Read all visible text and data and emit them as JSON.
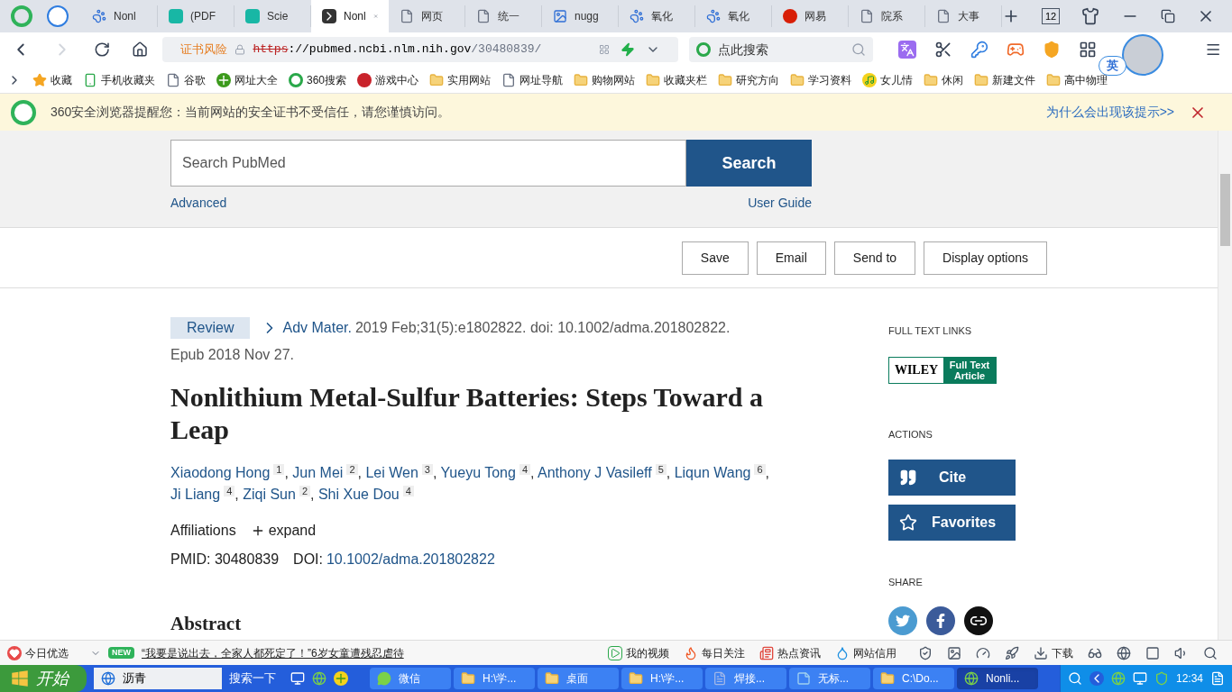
{
  "browser": {
    "tabs": [
      {
        "label": "Nonl",
        "kind": "paw",
        "selected": false
      },
      {
        "label": "(PDF",
        "kind": "rg",
        "selected": false
      },
      {
        "label": "Scie",
        "kind": "rg",
        "selected": false
      },
      {
        "label": "Nonl",
        "kind": "pubmed",
        "selected": true
      },
      {
        "label": "网页",
        "kind": "page",
        "selected": false
      },
      {
        "label": "统一",
        "kind": "page",
        "selected": false
      },
      {
        "label": "nugg",
        "kind": "photo",
        "selected": false
      },
      {
        "label": "氧化",
        "kind": "paw",
        "selected": false
      },
      {
        "label": "氧化",
        "kind": "paw",
        "selected": false
      },
      {
        "label": "网易",
        "kind": "netease",
        "selected": false
      },
      {
        "label": "院系",
        "kind": "page",
        "selected": false
      },
      {
        "label": "大事",
        "kind": "page",
        "selected": false
      }
    ],
    "tab_count": "12",
    "address": {
      "warning": "证书风险",
      "scheme": "https",
      "host": "://pubmed.ncbi.nlm.nih.gov",
      "path": "/30480839/"
    },
    "search": {
      "placeholder": "点此搜索"
    },
    "ime": "英",
    "bookmarks": [
      {
        "label": "收藏",
        "kind": "star"
      },
      {
        "label": "手机收藏夹",
        "kind": "phone"
      },
      {
        "label": "谷歌",
        "kind": "page"
      },
      {
        "label": "网址大全",
        "kind": "plus"
      },
      {
        "label": "360搜索",
        "kind": "ring"
      },
      {
        "label": "游戏中心",
        "kind": "game"
      },
      {
        "label": "实用网站",
        "kind": "folder"
      },
      {
        "label": "网址导航",
        "kind": "page"
      },
      {
        "label": "购物网站",
        "kind": "folder"
      },
      {
        "label": "收藏夹栏",
        "kind": "folder"
      },
      {
        "label": "研究方向",
        "kind": "folder"
      },
      {
        "label": "学习资料",
        "kind": "folder"
      },
      {
        "label": "女儿情",
        "kind": "music"
      },
      {
        "label": "休闲",
        "kind": "folder"
      },
      {
        "label": "新建文件",
        "kind": "folder"
      },
      {
        "label": "高中物理",
        "kind": "folder"
      }
    ],
    "notice": {
      "text": "360安全浏览器提醒您：当前网站的安全证书不受信任，请您谨慎访问。",
      "link": "为什么会出现该提示>>"
    }
  },
  "page": {
    "search": {
      "placeholder": "Search PubMed",
      "button": "Search",
      "advanced": "Advanced",
      "guide": "User Guide"
    },
    "actions": [
      "Save",
      "Email",
      "Send to",
      "Display options"
    ],
    "article": {
      "badge": "Review",
      "journal": "Adv Mater.",
      "citation": "2019 Feb;31(5):e1802822. doi: 10.1002/adma.201802822.",
      "epub": "Epub 2018 Nov 27.",
      "title": "Nonlithium Metal-Sulfur Batteries: Steps Toward a Leap",
      "authors": [
        {
          "name": "Xiaodong Hong",
          "aff": "1",
          "sep": ","
        },
        {
          "name": "Jun Mei",
          "aff": "2",
          "sep": ","
        },
        {
          "name": "Lei Wen",
          "aff": "3",
          "sep": ","
        },
        {
          "name": "Yueyu Tong",
          "aff": "4",
          "sep": ","
        },
        {
          "name": "Anthony J Vasileff",
          "aff": "5",
          "sep": ","
        },
        {
          "name": "Liqun Wang",
          "aff": "6",
          "sep": ","
        },
        {
          "name": "Ji Liang",
          "aff": "4",
          "sep": ","
        },
        {
          "name": "Ziqi Sun",
          "aff": "2",
          "sep": ","
        },
        {
          "name": "Shi Xue Dou",
          "aff": "4"
        }
      ],
      "affiliations": "Affiliations",
      "expand": "expand",
      "pmid": "PMID: 30480839",
      "doi_label": "DOI:",
      "doi": "10.1002/adma.201802822",
      "abstract": "Abstract"
    },
    "sidebar": {
      "full_text_heading": "FULL TEXT LINKS",
      "publisher": "WILEY",
      "publisher_link": "Full Text Article",
      "actions_heading": "ACTIONS",
      "cite": "Cite",
      "favorites": "Favorites",
      "share_heading": "SHARE"
    }
  },
  "status_bar": {
    "pick": "今日优选",
    "badge": "NEW",
    "headline": "“我要是说出去，全家人都死定了！”6岁女童遭残忍虐待",
    "items": [
      {
        "label": "我的视频",
        "kind": "video"
      },
      {
        "label": "每日关注",
        "kind": "flame"
      },
      {
        "label": "热点资讯",
        "kind": "news"
      },
      {
        "label": "网站信用",
        "kind": "drop"
      }
    ],
    "download": "下载"
  },
  "taskbar": {
    "start": "开始",
    "search_value": "沥青",
    "search_button": "搜索一下",
    "windows": [
      {
        "label": "微信",
        "kind": "wechat",
        "selected": false
      },
      {
        "label": "H:\\学...",
        "kind": "folder",
        "selected": false
      },
      {
        "label": "桌面",
        "kind": "folder",
        "selected": false
      },
      {
        "label": "H:\\学...",
        "kind": "folder",
        "selected": false
      },
      {
        "label": "焊接...",
        "kind": "doc",
        "selected": false
      },
      {
        "label": "无标...",
        "kind": "notepad",
        "selected": false
      },
      {
        "label": "C:\\Do...",
        "kind": "folder",
        "selected": false
      },
      {
        "label": "Nonli...",
        "kind": "browser",
        "selected": true
      }
    ],
    "clock": "12:34"
  }
}
